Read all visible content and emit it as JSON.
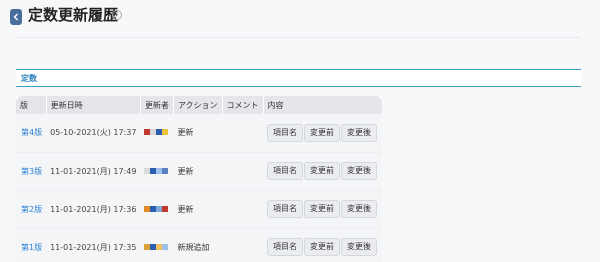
{
  "page": {
    "title": "定数更新履歴",
    "help_glyph": "?"
  },
  "section": {
    "label": "定数"
  },
  "table": {
    "headers": {
      "version": "版",
      "datetime": "更新日時",
      "updater": "更新者",
      "action": "アクション",
      "comment": "コメント",
      "content": "内容"
    },
    "buttons": {
      "item_name": "項目名",
      "before": "変更前",
      "after": "変更後"
    },
    "rows": [
      {
        "version": "第4版",
        "datetime": "05-10-2021(火) 17:37",
        "action": "更新",
        "comment": "",
        "avatar_colors": [
          "#c0392b",
          "#d9d9d9",
          "#2a5db0",
          "#e8c23a"
        ]
      },
      {
        "version": "第3版",
        "datetime": "11-01-2021(月) 17:49",
        "action": "更新",
        "comment": "",
        "avatar_colors": [
          "#d9d9d9",
          "#2a5db0",
          "#9cc0e8",
          "#5b7fbf"
        ]
      },
      {
        "version": "第2版",
        "datetime": "11-01-2021(月) 17:36",
        "action": "更新",
        "comment": "",
        "avatar_colors": [
          "#e08a2a",
          "#2a5db0",
          "#7fa9d8",
          "#c0392b"
        ]
      },
      {
        "version": "第1版",
        "datetime": "11-01-2021(月) 17:35",
        "action": "新規追加",
        "comment": "",
        "avatar_colors": [
          "#d9a23a",
          "#2a5db0",
          "#f0c060",
          "#9cc0e8"
        ]
      }
    ]
  },
  "colors": {
    "accent": "#2a7fd4",
    "section_rule": "#3aa0c8",
    "back_button": "#4a6e9c"
  },
  "icons": {
    "back": "chevron-left-icon",
    "help": "question-circle-icon"
  }
}
